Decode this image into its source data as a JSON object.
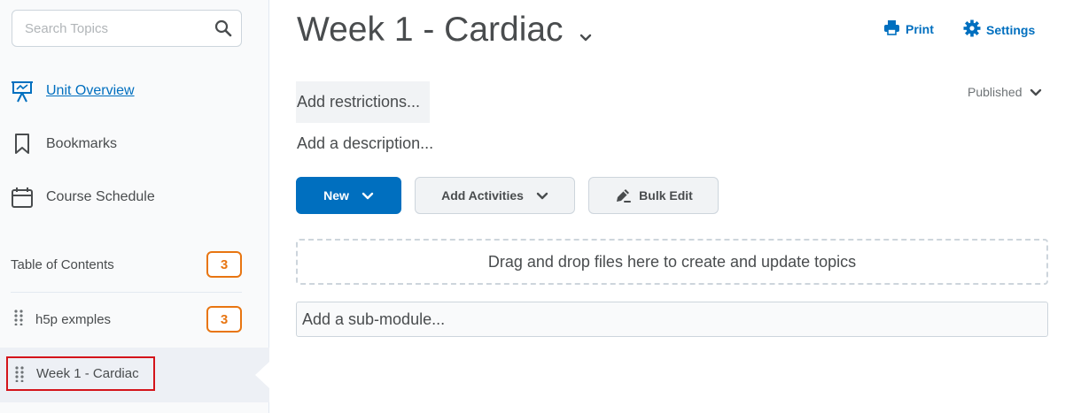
{
  "sidebar": {
    "search": {
      "placeholder": "Search Topics",
      "icon": "search-icon"
    },
    "nav": [
      {
        "label": "Unit Overview",
        "icon": "presentation-icon"
      },
      {
        "label": "Bookmarks",
        "icon": "bookmark-icon"
      },
      {
        "label": "Course Schedule",
        "icon": "calendar-icon"
      }
    ],
    "toc": {
      "label": "Table of Contents",
      "count": "3"
    },
    "modules": [
      {
        "label": "h5p exmples",
        "count": "3"
      },
      {
        "label": "Week 1 - Cardiac"
      }
    ]
  },
  "main": {
    "title": "Week 1 - Cardiac",
    "actions": {
      "print": "Print",
      "settings": "Settings"
    },
    "restrictions": "Add restrictions...",
    "status": "Published",
    "description": "Add a description...",
    "buttons": {
      "new": "New",
      "add_activities": "Add Activities",
      "bulk_edit": "Bulk Edit"
    },
    "dropzone": "Drag and drop files here to create and update topics",
    "submodule": "Add a sub-module..."
  },
  "colors": {
    "accent": "#006fbf",
    "badge": "#e87511",
    "highlight": "#d4141a"
  }
}
